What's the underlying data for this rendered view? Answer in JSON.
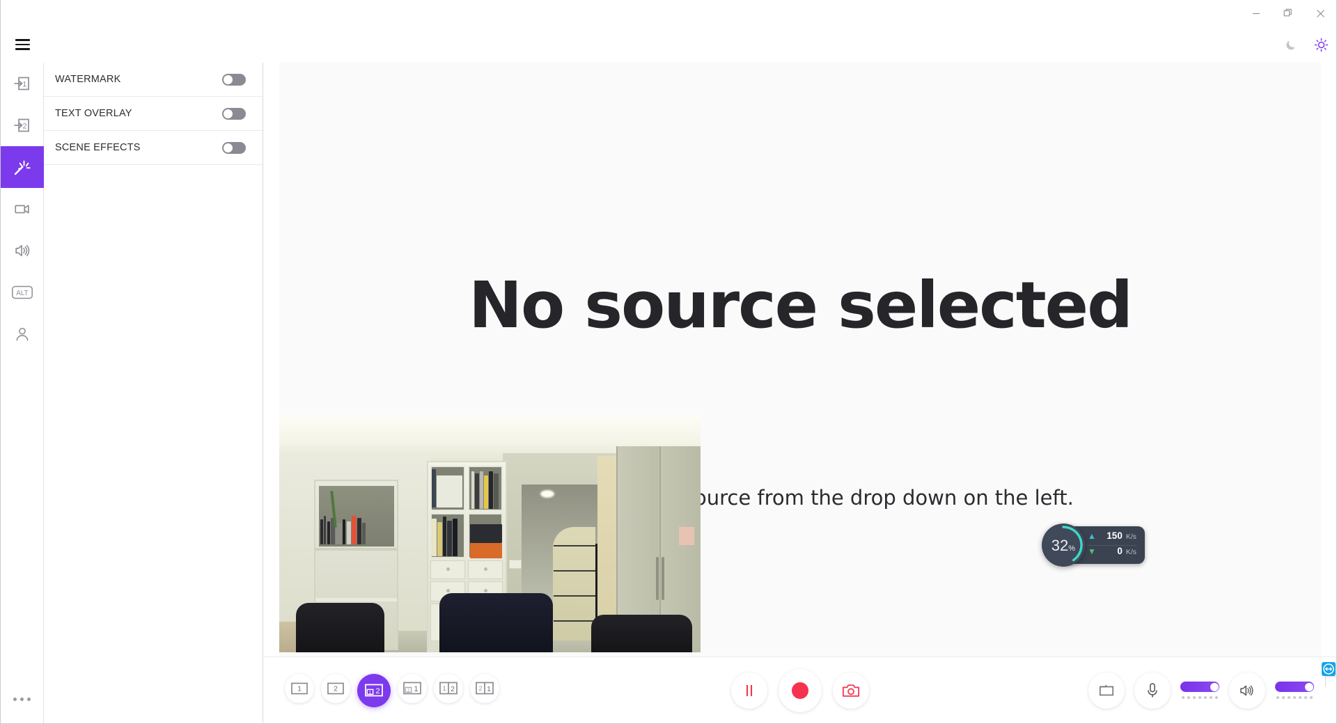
{
  "window": {
    "minimize_label": "Minimize",
    "restore_label": "Restore",
    "close_label": "Close"
  },
  "header": {
    "menu_label": "Menu",
    "dark_mode_label": "Dark mode",
    "light_mode_label": "Light mode",
    "active_theme": "light"
  },
  "rail": {
    "items": [
      {
        "id": "input-1",
        "icon": "input-one-icon",
        "label": "Input 1",
        "active": false
      },
      {
        "id": "input-2",
        "icon": "input-two-icon",
        "label": "Input 2",
        "active": false
      },
      {
        "id": "effects",
        "icon": "magic-wand-icon",
        "label": "Effects",
        "active": true
      },
      {
        "id": "video",
        "icon": "video-camera-icon",
        "label": "Video",
        "active": false
      },
      {
        "id": "audio",
        "icon": "speaker-icon",
        "label": "Audio",
        "active": false
      },
      {
        "id": "alt",
        "icon": "alt-key-icon",
        "label": "ALT",
        "active": false
      },
      {
        "id": "account",
        "icon": "person-icon",
        "label": "Account",
        "active": false
      }
    ],
    "more_label": "More options"
  },
  "panel": {
    "rows": [
      {
        "label": "WATERMARK",
        "enabled": false
      },
      {
        "label": "TEXT OVERLAY",
        "enabled": false
      },
      {
        "label": "SCENE EFFECTS",
        "enabled": false
      }
    ]
  },
  "stage": {
    "title": "No source selected",
    "subtitle": "Please select a source from the drop down on the left.",
    "webcam_label": "Webcam preview"
  },
  "performance": {
    "cpu_percent": "32",
    "cpu_unit": "%",
    "cpu_ring_color": "#3fd7c8",
    "upload_value": "150",
    "upload_unit": "K/s",
    "download_value": "0",
    "download_unit": "K/s"
  },
  "controls": {
    "layouts": [
      {
        "id": "layout-full-1",
        "label": "1",
        "active": false
      },
      {
        "id": "layout-full-2",
        "label": "2",
        "active": false
      },
      {
        "id": "layout-pip-1-in-2",
        "label": "1|2",
        "primary": "2",
        "inset": "1",
        "active": true
      },
      {
        "id": "layout-pip-2-in-1",
        "label": "2|1",
        "primary": "1",
        "inset": "2",
        "active": false
      },
      {
        "id": "layout-split-1-2",
        "label": "1 2",
        "left": "1",
        "right": "2",
        "active": false
      },
      {
        "id": "layout-split-2-1",
        "label": "2 1",
        "left": "2",
        "right": "1",
        "active": false
      }
    ],
    "pause_label": "Pause",
    "record_label": "Record",
    "snapshot_label": "Snapshot",
    "folder_label": "Open recordings folder",
    "mic_label": "Microphone",
    "mic_level": 100,
    "speaker_label": "Speaker",
    "speaker_level": 100,
    "tray_icon": "teamviewer-icon"
  },
  "colors": {
    "accent": "#7c3aed",
    "record": "#f5334f",
    "badge_bg": "#3b4351"
  }
}
